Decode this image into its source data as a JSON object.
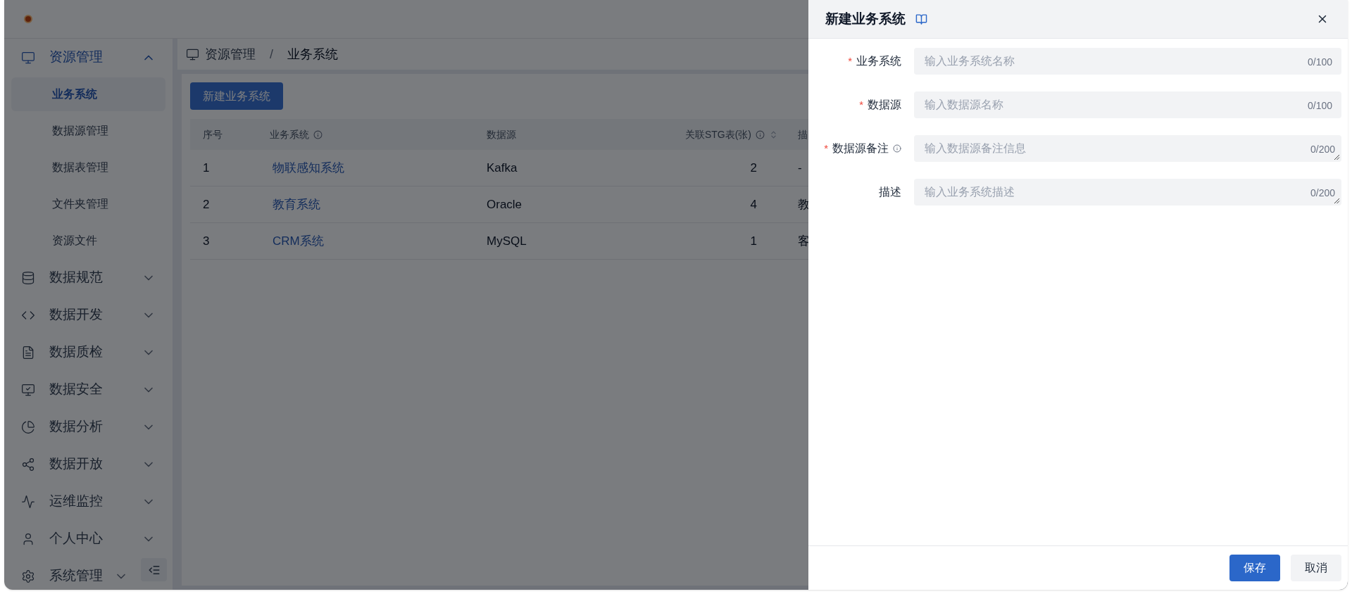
{
  "sidebar": {
    "items": [
      {
        "label": "资源管理",
        "expanded": true,
        "children": [
          {
            "label": "业务系统",
            "selected": true
          },
          {
            "label": "数据源管理",
            "selected": false
          },
          {
            "label": "数据表管理",
            "selected": false
          },
          {
            "label": "文件夹管理",
            "selected": false
          },
          {
            "label": "资源文件",
            "selected": false
          }
        ]
      },
      {
        "label": "数据规范",
        "expanded": false
      },
      {
        "label": "数据开发",
        "expanded": false
      },
      {
        "label": "数据质检",
        "expanded": false
      },
      {
        "label": "数据安全",
        "expanded": false
      },
      {
        "label": "数据分析",
        "expanded": false
      },
      {
        "label": "数据开放",
        "expanded": false
      },
      {
        "label": "运维监控",
        "expanded": false
      },
      {
        "label": "个人中心",
        "expanded": false
      },
      {
        "label": "系统管理",
        "expanded": false
      }
    ]
  },
  "breadcrumb": {
    "items": [
      "资源管理",
      "业务系统"
    ],
    "separator": "/"
  },
  "new_button": "新建业务系统",
  "table": {
    "columns": [
      {
        "label": "序号",
        "info": false,
        "sortable": false
      },
      {
        "label": "业务系统",
        "info": true,
        "sortable": false
      },
      {
        "label": "数据源",
        "info": false,
        "sortable": false
      },
      {
        "label": "关联STG表(张)",
        "info": true,
        "sortable": true
      },
      {
        "label": "描",
        "info": false,
        "sortable": false
      }
    ],
    "rows": [
      [
        "1",
        "物联感知系统",
        "Kafka",
        "2",
        "-"
      ],
      [
        "2",
        "教育系统",
        "Oracle",
        "4",
        "教"
      ],
      [
        "3",
        "CRM系统",
        "MySQL",
        "1",
        "客"
      ]
    ]
  },
  "drawer": {
    "title": "新建业务系统",
    "fields": [
      {
        "label": "业务系统",
        "required_mark": "*",
        "info": false,
        "kind": "input",
        "placeholder": "输入业务系统名称",
        "counter": "0/100"
      },
      {
        "label": "数据源",
        "required_mark": "*",
        "info": false,
        "kind": "input",
        "placeholder": "输入数据源名称",
        "counter": "0/100"
      },
      {
        "label": "数据源备注",
        "required_mark": "*",
        "info": true,
        "kind": "textarea",
        "placeholder": "输入数据源备注信息",
        "counter": "0/200"
      },
      {
        "label": "描述",
        "info": false,
        "kind": "textarea",
        "placeholder": "输入业务系统描述",
        "counter": "0/200"
      }
    ],
    "buttons": [
      {
        "label": "保存",
        "primary": true
      },
      {
        "label": "取消",
        "primary": false
      }
    ]
  }
}
